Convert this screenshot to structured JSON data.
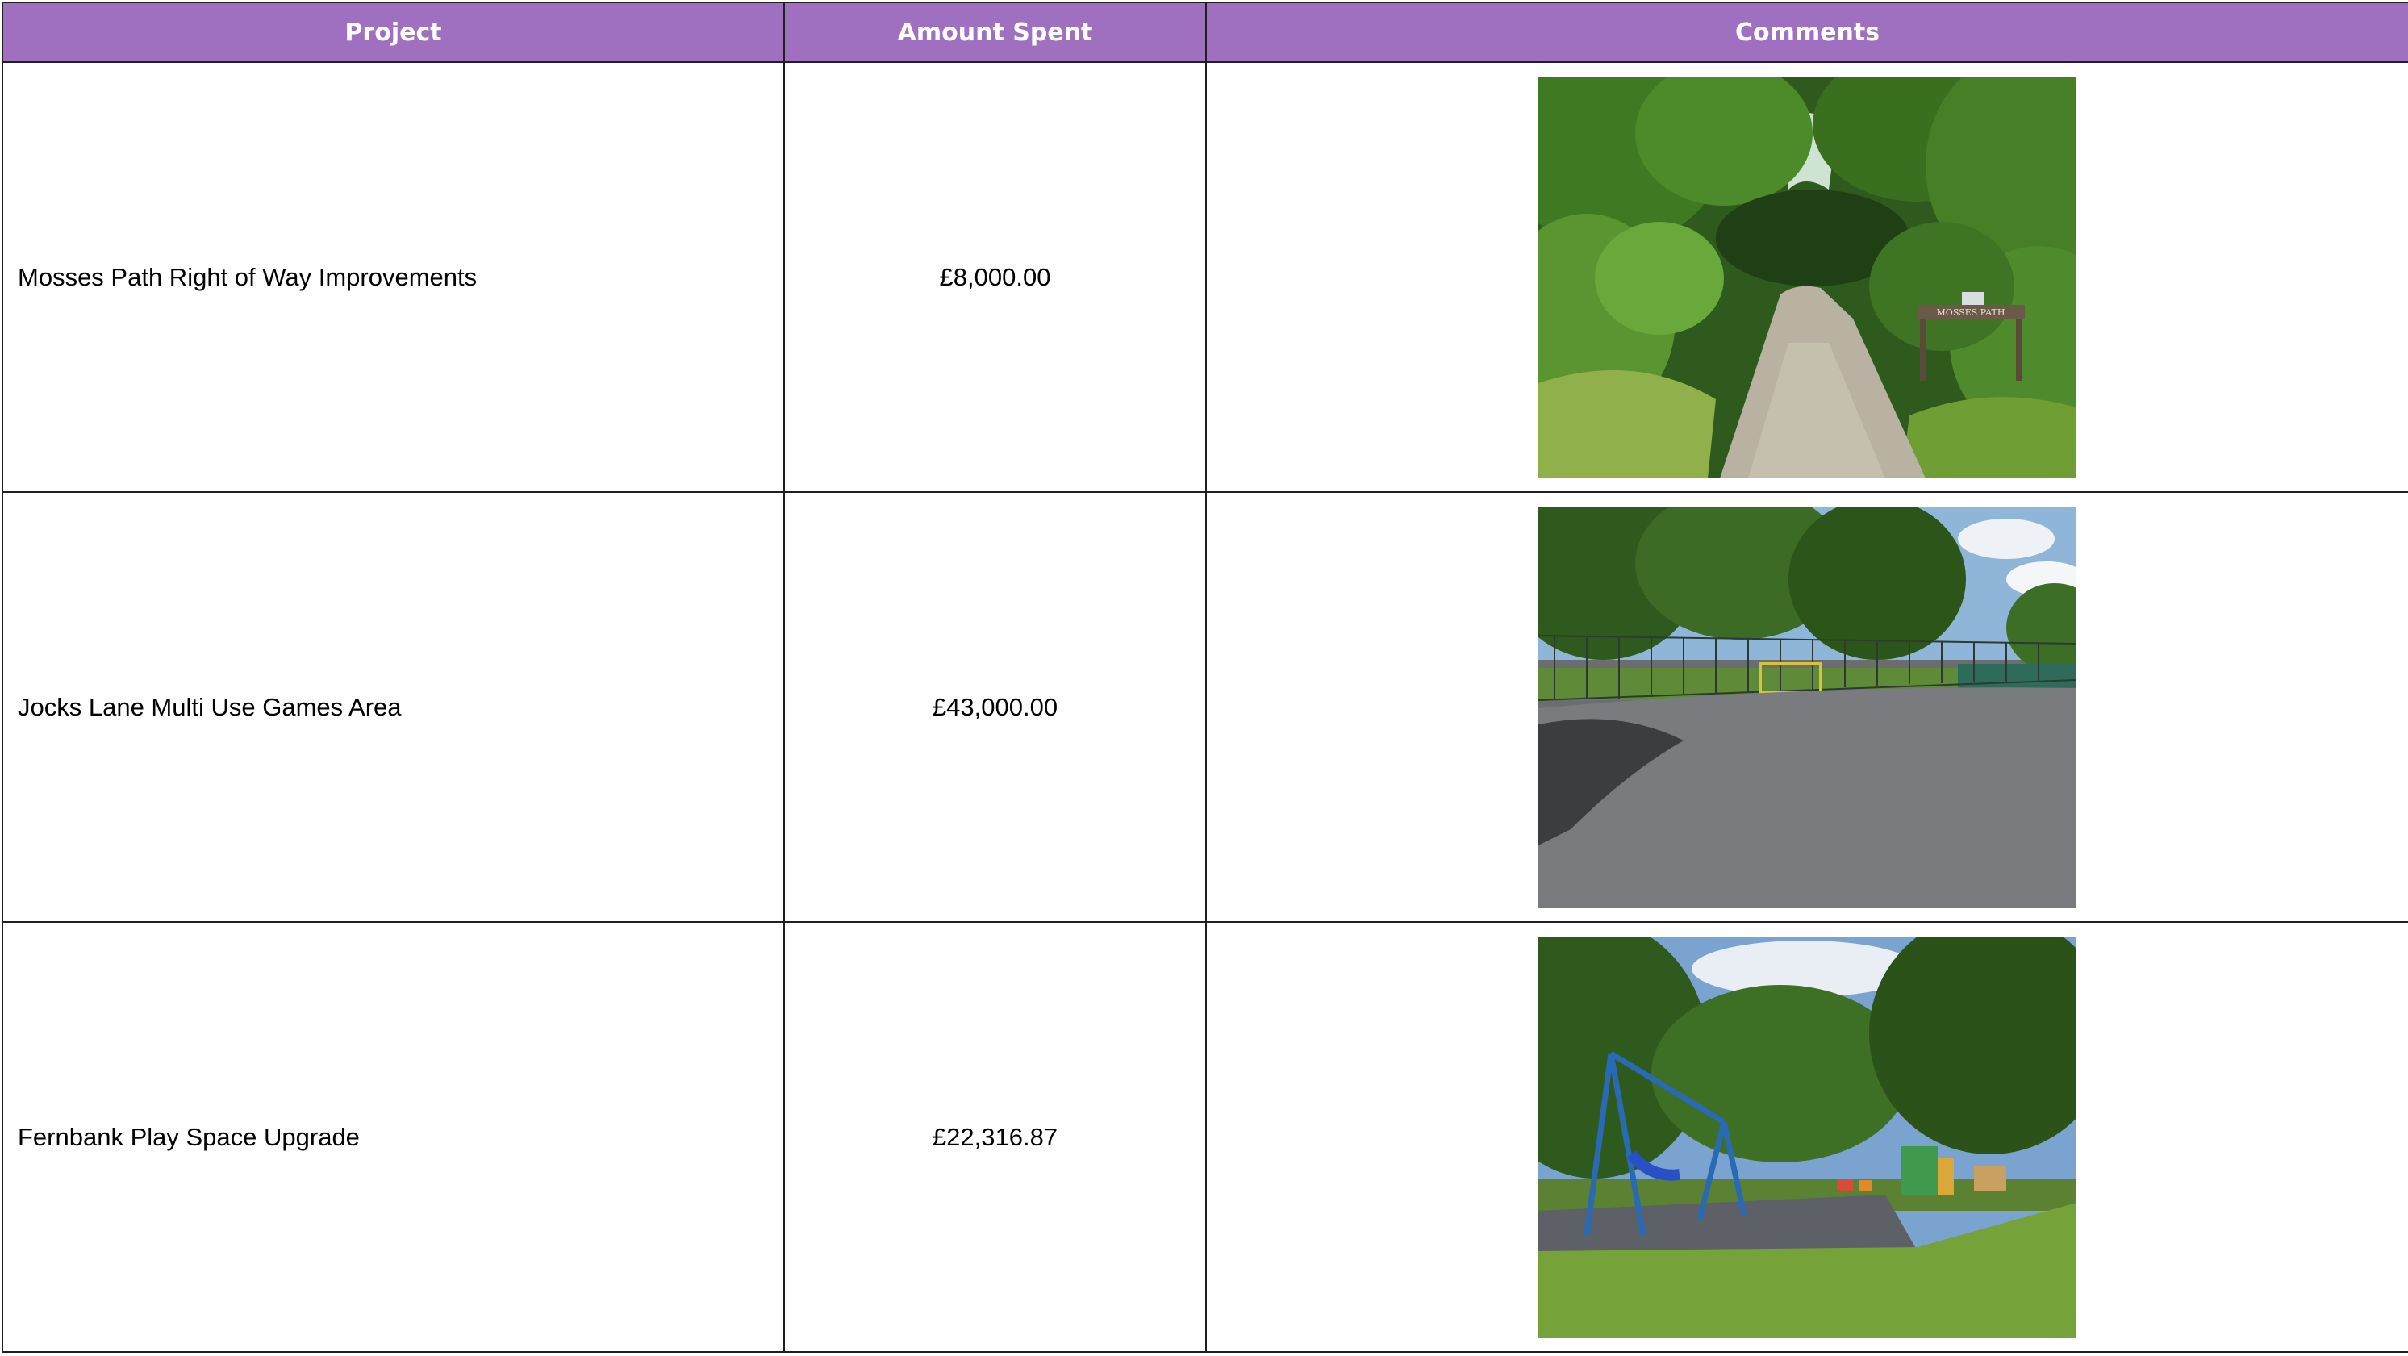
{
  "table": {
    "headers": {
      "project": "Project",
      "amount": "Amount Spent",
      "comments": "Comments"
    },
    "rows": [
      {
        "project": "Mosses Path Right of Way Improvements",
        "amount": "£8,000.00",
        "sign_text": "MOSSES PATH"
      },
      {
        "project": "Jocks Lane Multi Use Games Area",
        "amount": "£43,000.00"
      },
      {
        "project": "Fernbank Play Space Upgrade",
        "amount": "£22,316.87"
      }
    ]
  },
  "colors": {
    "header_background": "#a070c0",
    "header_text": "#ffffff",
    "border": "#1f1f1f"
  }
}
